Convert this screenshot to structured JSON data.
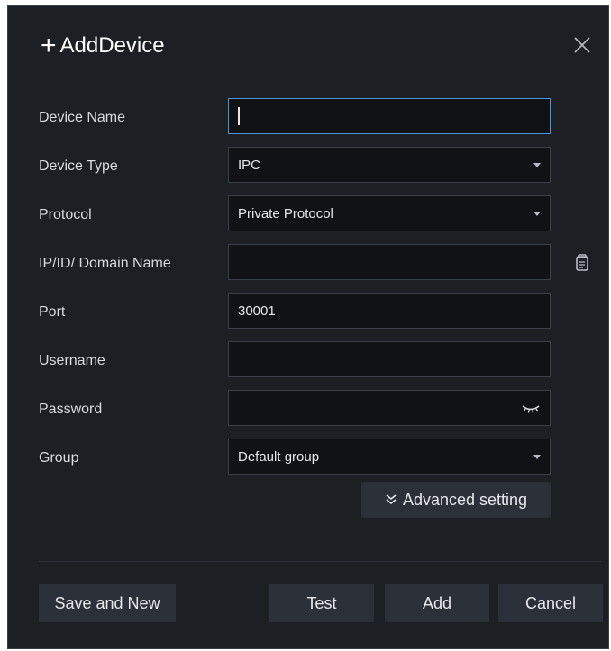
{
  "dialog": {
    "title": "AddDevice",
    "title_icon": "plus-icon",
    "close_icon": "close-icon"
  },
  "form": {
    "device_name": {
      "label": "Device Name",
      "value": ""
    },
    "device_type": {
      "label": "Device Type",
      "value": "IPC"
    },
    "protocol": {
      "label": "Protocol",
      "value": "Private Protocol"
    },
    "ip": {
      "label": "IP/ID/ Domain Name",
      "value": ""
    },
    "port": {
      "label": "Port",
      "value": "30001"
    },
    "username": {
      "label": "Username",
      "value": ""
    },
    "password": {
      "label": "Password",
      "value": ""
    },
    "group": {
      "label": "Group",
      "value": "Default group"
    }
  },
  "advanced": {
    "label": "Advanced setting",
    "icon": "double-chevron-down-icon"
  },
  "buttons": {
    "save_new": "Save and New",
    "test": "Test",
    "add": "Add",
    "cancel": "Cancel"
  },
  "colors": {
    "dialog_bg": "#1c1f24",
    "field_bg": "#101216",
    "button_bg": "#2c3038",
    "focus_border": "#4a93d6"
  }
}
